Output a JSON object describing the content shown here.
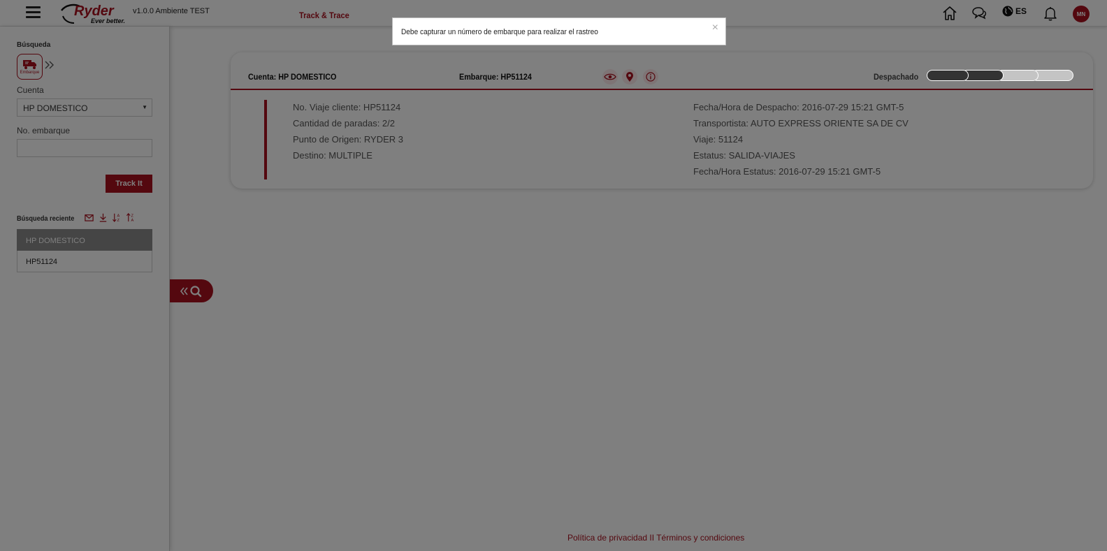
{
  "header": {
    "logo_brand": "Ryder",
    "logo_tagline": "Ever better.",
    "version": "v1.0.0 Ambiente TEST",
    "nav_link": "Track & Trace",
    "language": "ES",
    "user_initials": "MN",
    "icons": [
      "home-icon",
      "chat-icon",
      "globe-icon",
      "bell-icon"
    ]
  },
  "sidebar": {
    "search_title": "Búsqueda",
    "embarque_label": "Embarque",
    "account_label": "Cuenta",
    "account_value": "HP DOMESTICO",
    "shipment_label": "No. embarque",
    "shipment_value": "",
    "track_button": "Track It",
    "recent_title": "Búsqueda reciente",
    "recent_items": [
      "HP DOMESTICO",
      "HP51124"
    ]
  },
  "card": {
    "account": "Cuenta: HP DOMESTICO",
    "shipment": "Embarque: HP51124",
    "status": "Despachado",
    "progress": {
      "completed_steps": 2,
      "total_steps": 4
    },
    "colors": {
      "done": "#333333",
      "pending": "#c4c4c4",
      "accent": "#a8101e"
    },
    "left_info": [
      "No. Viaje cliente: HP51124",
      "Cantidad de paradas: 2/2",
      "Punto de Origen: RYDER 3",
      "Destino: MULTIPLE"
    ],
    "right_info": [
      "Fecha/Hora de Despacho: 2016-07-29 15:21 GMT-5",
      "Transportista: AUTO EXPRESS ORIENTE SA DE CV",
      "Viaje: 51124",
      "Estatus: SALIDA-VIAJES",
      "Fecha/Hora Estatus: 2016-07-29 15:21 GMT-5"
    ]
  },
  "alert": {
    "message": "Debe capturar un número de embarque para realizar el rastreo",
    "close": "×"
  },
  "footer": {
    "privacy": "Política de privacidad",
    "separator": " II ",
    "terms": "Términos y condiciones"
  }
}
